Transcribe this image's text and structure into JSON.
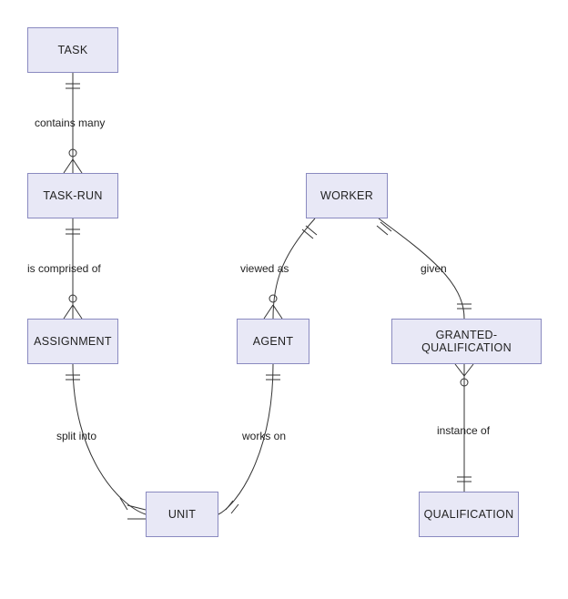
{
  "entities": {
    "task": "TASK",
    "task_run": "TASK-RUN",
    "assignment": "ASSIGNMENT",
    "unit": "UNIT",
    "agent": "AGENT",
    "worker": "WORKER",
    "granted_qualification": "GRANTED-QUALIFICATION",
    "qualification": "QUALIFICATION"
  },
  "relationships": {
    "task__task_run": "contains many",
    "task_run__assignment": "is comprised of",
    "assignment__unit": "split into",
    "agent__unit": "works on",
    "worker__agent": "viewed as",
    "worker__granted_qualification": "given",
    "granted_qualification__qualification": "instance of"
  }
}
